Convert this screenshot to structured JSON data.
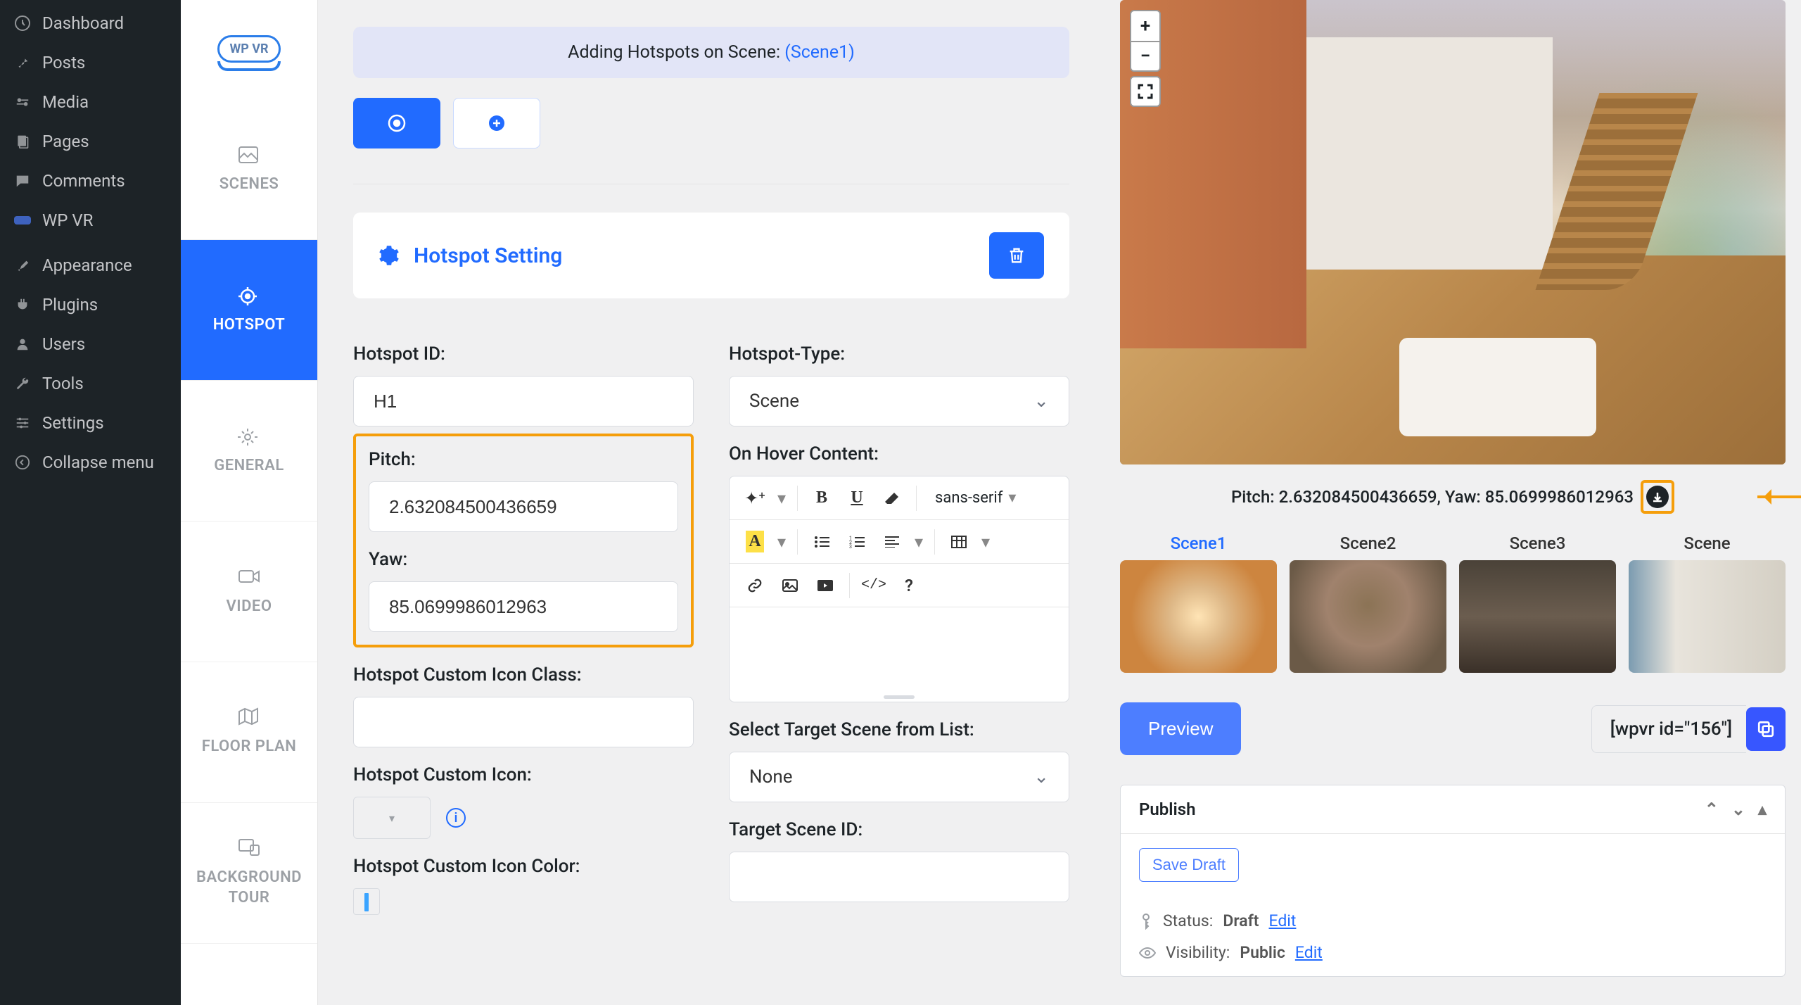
{
  "wp_menu": {
    "dashboard": "Dashboard",
    "posts": "Posts",
    "media": "Media",
    "pages": "Pages",
    "comments": "Comments",
    "wpvr": "WP VR",
    "appearance": "Appearance",
    "plugins": "Plugins",
    "users": "Users",
    "tools": "Tools",
    "settings": "Settings",
    "collapse": "Collapse menu"
  },
  "vr_tabs": {
    "scenes": "SCENES",
    "hotspot": "HOTSPOT",
    "general": "GENERAL",
    "video": "VIDEO",
    "floor": "FLOOR PLAN",
    "bg": "BACKGROUND TOUR"
  },
  "banner": {
    "prefix": "Adding Hotspots on Scene: ",
    "scene": "(Scene1)"
  },
  "hotspot": {
    "title": "Hotspot Setting",
    "id_label": "Hotspot ID:",
    "id_value": "H1",
    "type_label": "Hotspot-Type:",
    "type_value": "Scene",
    "pitch_label": "Pitch:",
    "pitch_value": "2.632084500436659",
    "yaw_label": "Yaw:",
    "yaw_value": "85.0699986012963",
    "icon_class_label": "Hotspot Custom Icon Class:",
    "icon_label": "Hotspot Custom Icon:",
    "icon_color_label": "Hotspot Custom Icon Color:",
    "hover_label": "On Hover Content:",
    "target_list_label": "Select Target Scene from List:",
    "target_list_value": "None",
    "target_id_label": "Target Scene ID:",
    "font": "sans-serif"
  },
  "preview": {
    "coord": "Pitch: 2.632084500436659, Yaw: 85.0699986012963",
    "scenes": [
      "Scene1",
      "Scene2",
      "Scene3",
      "Scene"
    ],
    "preview_btn": "Preview",
    "shortcode": "[wpvr id=\"156\"]"
  },
  "publish": {
    "title": "Publish",
    "save_draft": "Save Draft",
    "status_k": "Status:",
    "status_v": "Draft",
    "edit": "Edit",
    "vis_k": "Visibility:",
    "vis_v": "Public"
  }
}
